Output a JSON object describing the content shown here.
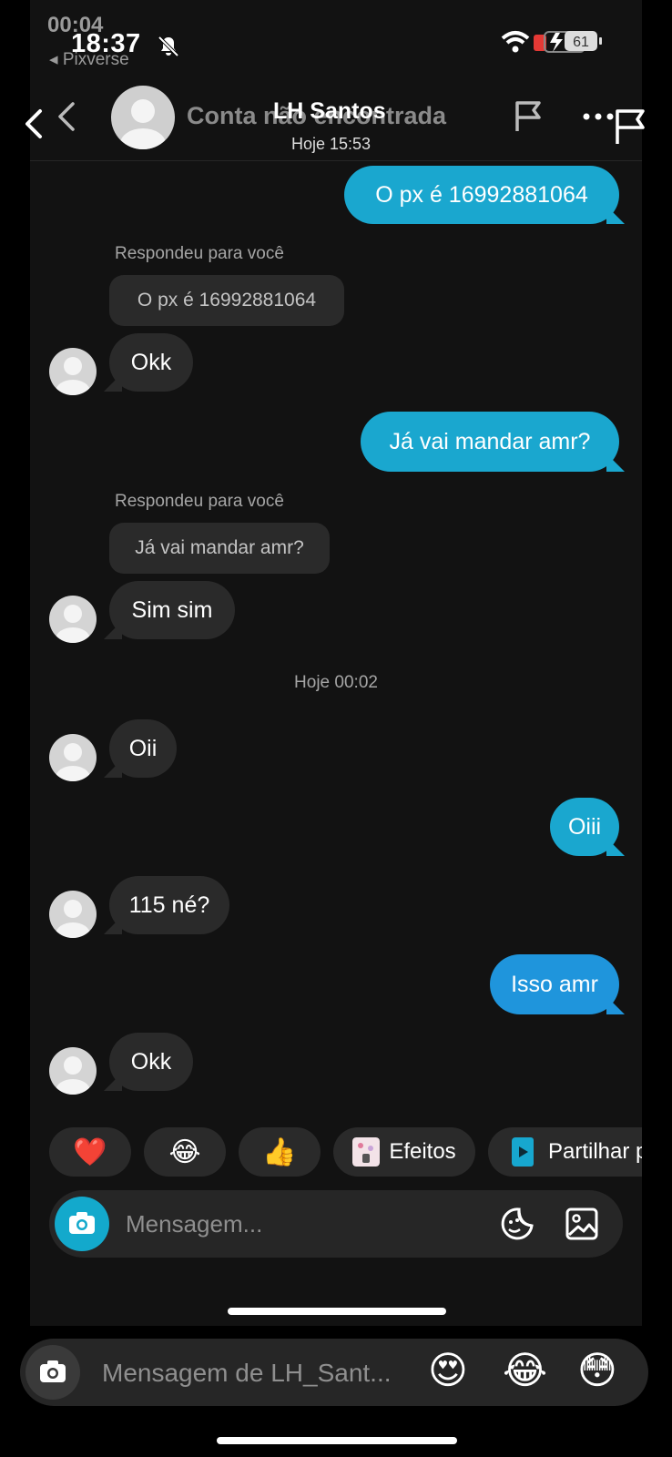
{
  "status_bar": {
    "ghost_time": "00:04",
    "time": "18:37",
    "back_app": "◂ Pixverse",
    "battery": "61"
  },
  "header": {
    "ghost_name": "Conta não encontrada",
    "name": "LH Santos",
    "subtitle": "Hoje 15:53"
  },
  "messages": [
    {
      "text": "O px é 16992881064"
    },
    {
      "reply_label": "Respondeu para você",
      "quote": "O px é 16992881064",
      "text": "Okk"
    },
    {
      "text": "Já vai mandar amr?"
    },
    {
      "reply_label": "Respondeu para você",
      "quote": "Já vai mandar amr?",
      "text": "Sim sim"
    },
    {
      "timestamp": "Hoje 00:02"
    },
    {
      "text": "Oii"
    },
    {
      "text": "Oiii"
    },
    {
      "text": "115 né?"
    },
    {
      "text": "Isso amr"
    },
    {
      "text": "Okk"
    }
  ],
  "quick_reactions": {
    "heart": "❤️",
    "laugh": "😂",
    "thumbs": "👍",
    "effects": "Efeitos",
    "share": "Partilhar p"
  },
  "composer": {
    "placeholder": "Mensagem..."
  },
  "outer_composer": {
    "placeholder": "Mensagem de LH_Sant...",
    "emoji1": "😍",
    "emoji2": "😂",
    "emoji3": "😳"
  },
  "colors": {
    "sent_bubble": "#1aa7cf",
    "sent_bubble_alt": "#1f95dc",
    "received_bubble": "#2a2a2a",
    "background": "#121212"
  }
}
